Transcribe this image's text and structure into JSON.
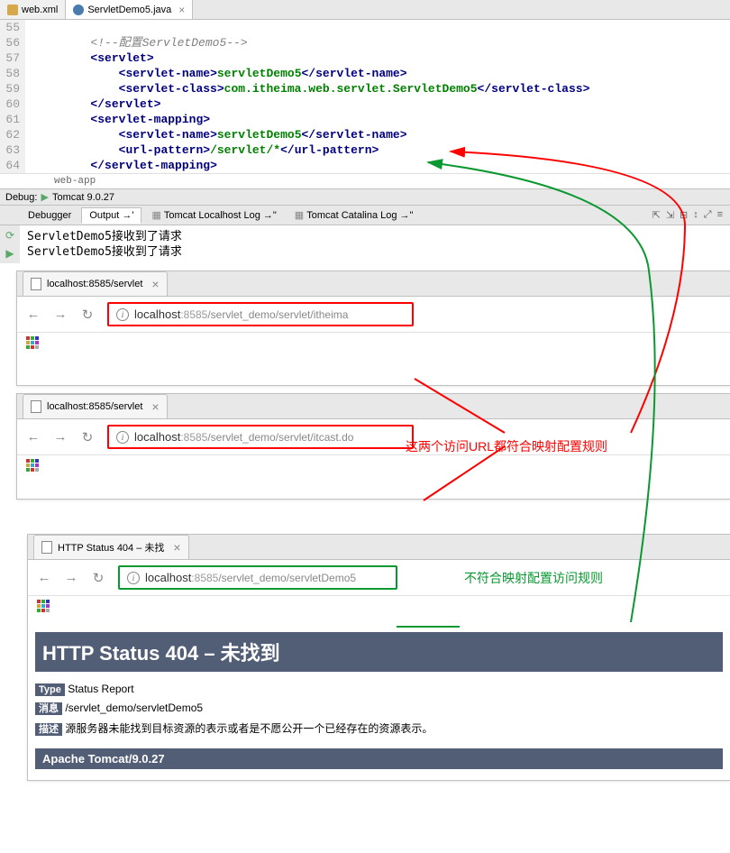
{
  "editor": {
    "tabs": [
      {
        "label": "web.xml",
        "icon": "xml"
      },
      {
        "label": "ServletDemo5.java",
        "icon": "java"
      }
    ],
    "lines": [
      "55",
      "56",
      "57",
      "58",
      "59",
      "60",
      "61",
      "62",
      "63",
      "64"
    ],
    "code": {
      "l56_comment": "<!--配置ServletDemo5-->",
      "servlet_open": "servlet",
      "servlet_name_tag": "servlet-name",
      "servlet_name_val": "servletDemo5",
      "servlet_class_tag": "servlet-class",
      "servlet_class_val": "com.itheima.web.servlet.ServletDemo5",
      "servlet_close": "servlet",
      "mapping_open": "servlet-mapping",
      "url_pattern_tag": "url-pattern",
      "url_pattern_val": "/servlet/*",
      "mapping_close": "servlet-mapping"
    },
    "breadcrumb": "web-app"
  },
  "debug": {
    "label": "Debug:",
    "config": "Tomcat 9.0.27"
  },
  "tool_tabs": {
    "debugger": "Debugger",
    "output": "Output",
    "log1": "Tomcat Localhost Log",
    "log2": "Tomcat Catalina Log"
  },
  "console": {
    "line1": "ServletDemo5接收到了请求",
    "line2": "ServletDemo5接收到了请求"
  },
  "browser1": {
    "tab_title": "localhost:8585/servlet",
    "url_host": "localhost",
    "url_port": ":8585",
    "url_path": "/servlet_demo/servlet/itheima"
  },
  "browser2": {
    "tab_title": "localhost:8585/servlet",
    "url_host": "localhost",
    "url_port": ":8585",
    "url_path": "/servlet_demo/servlet/itcast.do"
  },
  "browser3": {
    "tab_title": "HTTP Status 404 – 未找",
    "url_host": "localhost",
    "url_port": ":8585",
    "url_path": "/servlet_demo/servletDemo5"
  },
  "error": {
    "title": "HTTP Status 404 – 未找到",
    "type_label": "Type",
    "type_val": " Status Report",
    "msg_label": "消息",
    "msg_val": " /servlet_demo/servletDemo5",
    "desc_label": "描述",
    "desc_val": " 源服务器未能找到目标资源的表示或者是不愿公开一个已经存在的资源表示。",
    "footer": "Apache Tomcat/9.0.27"
  },
  "annotations": {
    "red": "这两个访问URL都符合映射配置规则",
    "green": "不符合映射配置访问规则"
  }
}
